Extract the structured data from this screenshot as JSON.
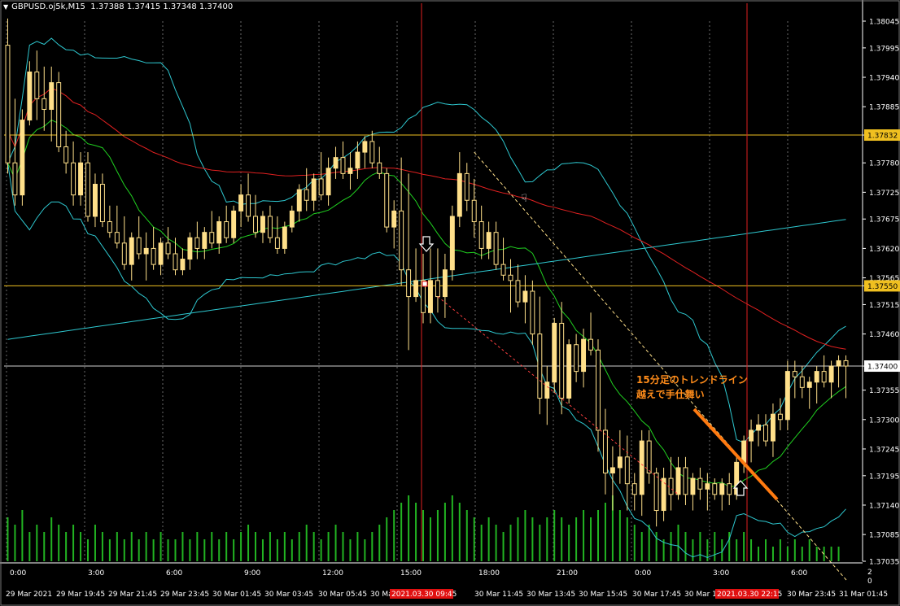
{
  "header": {
    "symbol_info": "GBPUSD.oj5k,M15",
    "ohlc": "1.37388 1.37415 1.37348 1.37400"
  },
  "colors": {
    "background": "#000000",
    "candle": "#ffe08a",
    "volume": "#22b422",
    "grid": "#6a6a6a",
    "ma_slow": "#e02020",
    "ma_mid": "#20d020",
    "ma_long": "#2ec8d0",
    "bollinger": "#2ec8d0",
    "level_line": "#f0c020",
    "time_marker": "#e02020",
    "trendline": "#ff7a10",
    "annotation_text": "#ff8c1a"
  },
  "annotation": {
    "line1": "15分足のトレンドライン",
    "line2": "越えで手仕舞い"
  },
  "icons": [
    "sell-arrow-icon",
    "buy-arrow-icon",
    "thumbs-down-icon"
  ],
  "chart_data": {
    "type": "candlestick",
    "ylim": [
      1.37035,
      1.38045
    ],
    "price_ticks": [
      "1.38045",
      "1.37995",
      "1.37940",
      "1.37885",
      "1.37832",
      "1.37780",
      "1.37725",
      "1.37675",
      "1.37620",
      "1.37565",
      "1.37550",
      "1.37515",
      "1.37460",
      "1.37400",
      "1.37355",
      "1.37300",
      "1.37245",
      "1.37195",
      "1.37140",
      "1.37085",
      "1.37035"
    ],
    "highlight_levels": [
      {
        "price": 1.37832,
        "label": "1.37832",
        "style": "yellow"
      },
      {
        "price": 1.3755,
        "label": "1.37550",
        "style": "yellow"
      },
      {
        "price": 1.374,
        "label": "1.37400",
        "style": "white"
      }
    ],
    "time_ticks_top": [
      "0:00",
      "3:00",
      "6:00",
      "9:00",
      "12:00",
      "15:00",
      "18:00",
      "21:00",
      "0:00",
      "3:00",
      "6:00"
    ],
    "time_ticks_bottom": [
      "29 Mar 2021",
      "29 Mar 19:45",
      "29 Mar 21:45",
      "29 Mar 23:45",
      "30 Mar 01:45",
      "30 Mar 03:45",
      "30 Mar 05:45",
      "30 Mar 0",
      "2021.03.30 09:45",
      "30 Mar 11:45",
      "30 Mar 13:45",
      "30 Mar 15:45",
      "30 Mar 17:45",
      "30 Mar 19",
      "2021.03.30 22:15",
      "30 Mar 23:45",
      "31 Mar 01:45"
    ],
    "marker_times": [
      "2021.03.30 09:45",
      "2021.03.30 22:15"
    ],
    "volume_axis_labels": [
      "2",
      "0"
    ],
    "candles": [
      [
        1.38,
        1.3805,
        1.3776,
        1.3778
      ],
      [
        1.3778,
        1.379,
        1.377,
        1.3772
      ],
      [
        1.3772,
        1.3788,
        1.377,
        1.3786
      ],
      [
        1.3786,
        1.3797,
        1.3785,
        1.3795
      ],
      [
        1.3795,
        1.3799,
        1.3786,
        1.379
      ],
      [
        1.379,
        1.3796,
        1.3784,
        1.3788
      ],
      [
        1.3788,
        1.3796,
        1.3782,
        1.3793
      ],
      [
        1.3793,
        1.3795,
        1.378,
        1.3781
      ],
      [
        1.3781,
        1.3784,
        1.3776,
        1.3778
      ],
      [
        1.3778,
        1.3782,
        1.377,
        1.3772
      ],
      [
        1.3772,
        1.378,
        1.377,
        1.3778
      ],
      [
        1.3778,
        1.378,
        1.3767,
        1.3768
      ],
      [
        1.3768,
        1.3776,
        1.3766,
        1.3774
      ],
      [
        1.3774,
        1.3776,
        1.3766,
        1.3767
      ],
      [
        1.3767,
        1.377,
        1.3764,
        1.3765
      ],
      [
        1.3765,
        1.377,
        1.3762,
        1.3763
      ],
      [
        1.3763,
        1.3768,
        1.3758,
        1.3759
      ],
      [
        1.3759,
        1.3765,
        1.3756,
        1.3764
      ],
      [
        1.3764,
        1.3768,
        1.376,
        1.3761
      ],
      [
        1.3761,
        1.3765,
        1.3756,
        1.3762
      ],
      [
        1.3762,
        1.3766,
        1.3758,
        1.3759
      ],
      [
        1.3759,
        1.3764,
        1.3757,
        1.3763
      ],
      [
        1.3763,
        1.3766,
        1.376,
        1.3761
      ],
      [
        1.3761,
        1.3764,
        1.3757,
        1.3758
      ],
      [
        1.3758,
        1.3762,
        1.3757,
        1.376
      ],
      [
        1.376,
        1.3765,
        1.3758,
        1.3764
      ],
      [
        1.3764,
        1.3767,
        1.376,
        1.3762
      ],
      [
        1.3762,
        1.3766,
        1.376,
        1.3765
      ],
      [
        1.3765,
        1.3769,
        1.3762,
        1.3763
      ],
      [
        1.3763,
        1.3768,
        1.3761,
        1.3767
      ],
      [
        1.3767,
        1.377,
        1.3763,
        1.3764
      ],
      [
        1.3764,
        1.377,
        1.3763,
        1.3769
      ],
      [
        1.3769,
        1.3774,
        1.3766,
        1.3772
      ],
      [
        1.3772,
        1.3776,
        1.3767,
        1.3768
      ],
      [
        1.3768,
        1.3772,
        1.3764,
        1.3765
      ],
      [
        1.3765,
        1.3769,
        1.3763,
        1.3768
      ],
      [
        1.3768,
        1.377,
        1.3763,
        1.3764
      ],
      [
        1.3764,
        1.3768,
        1.3761,
        1.3762
      ],
      [
        1.3762,
        1.3767,
        1.3761,
        1.3766
      ],
      [
        1.3766,
        1.377,
        1.3765,
        1.3769
      ],
      [
        1.3769,
        1.3774,
        1.3767,
        1.3773
      ],
      [
        1.3773,
        1.3777,
        1.3769,
        1.3771
      ],
      [
        1.3771,
        1.3776,
        1.3769,
        1.3775
      ],
      [
        1.3775,
        1.378,
        1.3771,
        1.3772
      ],
      [
        1.3772,
        1.3779,
        1.377,
        1.3777
      ],
      [
        1.3777,
        1.3781,
        1.3775,
        1.3779
      ],
      [
        1.3779,
        1.3782,
        1.3775,
        1.3776
      ],
      [
        1.3776,
        1.378,
        1.3773,
        1.3777
      ],
      [
        1.3777,
        1.3782,
        1.3775,
        1.378
      ],
      [
        1.378,
        1.3783,
        1.3777,
        1.3782
      ],
      [
        1.3782,
        1.3784,
        1.3777,
        1.3778
      ],
      [
        1.3778,
        1.3781,
        1.3775,
        1.3776
      ],
      [
        1.3776,
        1.3777,
        1.3765,
        1.3766
      ],
      [
        1.3766,
        1.3771,
        1.3762,
        1.3769
      ],
      [
        1.3769,
        1.3779,
        1.3755,
        1.3758
      ],
      [
        1.3758,
        1.3776,
        1.3743,
        1.3753
      ],
      [
        1.3753,
        1.3762,
        1.3752,
        1.3756
      ],
      [
        1.3756,
        1.3761,
        1.3748,
        1.375
      ],
      [
        1.375,
        1.3762,
        1.3748,
        1.3756
      ],
      [
        1.3756,
        1.3762,
        1.375,
        1.3753
      ],
      [
        1.3753,
        1.3761,
        1.3749,
        1.3758
      ],
      [
        1.3758,
        1.377,
        1.3756,
        1.3768
      ],
      [
        1.3768,
        1.378,
        1.3766,
        1.3776
      ],
      [
        1.3776,
        1.3778,
        1.3769,
        1.3771
      ],
      [
        1.3771,
        1.3775,
        1.3764,
        1.3767
      ],
      [
        1.3767,
        1.377,
        1.376,
        1.3762
      ],
      [
        1.3762,
        1.3767,
        1.376,
        1.3765
      ],
      [
        1.3765,
        1.3767,
        1.3758,
        1.3759
      ],
      [
        1.3759,
        1.3764,
        1.3756,
        1.3757
      ],
      [
        1.3757,
        1.376,
        1.375,
        1.3756
      ],
      [
        1.3756,
        1.3759,
        1.3751,
        1.3752
      ],
      [
        1.3752,
        1.3757,
        1.3748,
        1.3754
      ],
      [
        1.3754,
        1.3756,
        1.3744,
        1.3746
      ],
      [
        1.3746,
        1.3753,
        1.3731,
        1.3734
      ],
      [
        1.3734,
        1.374,
        1.3729,
        1.3737
      ],
      [
        1.3737,
        1.3749,
        1.3735,
        1.3748
      ],
      [
        1.3748,
        1.3752,
        1.3731,
        1.3734
      ],
      [
        1.3734,
        1.3745,
        1.3733,
        1.3744
      ],
      [
        1.3744,
        1.3746,
        1.3737,
        1.3739
      ],
      [
        1.3739,
        1.3747,
        1.3736,
        1.3745
      ],
      [
        1.3745,
        1.375,
        1.3742,
        1.3743
      ],
      [
        1.3743,
        1.3745,
        1.3724,
        1.3728
      ],
      [
        1.3728,
        1.3732,
        1.3716,
        1.372
      ],
      [
        1.372,
        1.3725,
        1.3713,
        1.3721
      ],
      [
        1.3721,
        1.3728,
        1.3718,
        1.3723
      ],
      [
        1.3723,
        1.3727,
        1.3713,
        1.3718
      ],
      [
        1.3718,
        1.372,
        1.3713,
        1.3716
      ],
      [
        1.3716,
        1.3728,
        1.3712,
        1.3726
      ],
      [
        1.3726,
        1.3728,
        1.3718,
        1.372
      ],
      [
        1.372,
        1.3721,
        1.371,
        1.3713
      ],
      [
        1.3713,
        1.3721,
        1.3711,
        1.3719
      ],
      [
        1.3719,
        1.3723,
        1.3713,
        1.3716
      ],
      [
        1.3716,
        1.3723,
        1.3715,
        1.3721
      ],
      [
        1.3721,
        1.3723,
        1.3714,
        1.3716
      ],
      [
        1.3716,
        1.372,
        1.3713,
        1.3719
      ],
      [
        1.3719,
        1.3721,
        1.3715,
        1.3717
      ],
      [
        1.3717,
        1.372,
        1.3713,
        1.3718
      ],
      [
        1.3718,
        1.3719,
        1.3715,
        1.3716
      ],
      [
        1.3716,
        1.3719,
        1.3713,
        1.3718
      ],
      [
        1.3718,
        1.372,
        1.3714,
        1.3716
      ],
      [
        1.3716,
        1.3723,
        1.3715,
        1.3722
      ],
      [
        1.3722,
        1.3727,
        1.372,
        1.3726
      ],
      [
        1.3726,
        1.373,
        1.3722,
        1.3728
      ],
      [
        1.3728,
        1.3731,
        1.3725,
        1.3729
      ],
      [
        1.3729,
        1.3731,
        1.3725,
        1.3726
      ],
      [
        1.3726,
        1.3733,
        1.3723,
        1.3731
      ],
      [
        1.3731,
        1.3734,
        1.3728,
        1.373
      ],
      [
        1.373,
        1.3741,
        1.3728,
        1.3739
      ],
      [
        1.3739,
        1.3741,
        1.3734,
        1.3738
      ],
      [
        1.3738,
        1.374,
        1.3734,
        1.3736
      ],
      [
        1.3736,
        1.3738,
        1.3732,
        1.3737
      ],
      [
        1.3737,
        1.374,
        1.3733,
        1.3739
      ],
      [
        1.3739,
        1.3742,
        1.3736,
        1.3737
      ],
      [
        1.3737,
        1.3741,
        1.3734,
        1.374
      ],
      [
        1.374,
        1.3742,
        1.3736,
        1.3741
      ],
      [
        1.3741,
        1.3742,
        1.3734,
        1.374
      ]
    ],
    "volumes": [
      6,
      5,
      7,
      4,
      5,
      4,
      6,
      5,
      4,
      5,
      4,
      3,
      5,
      4,
      3,
      4,
      3,
      4,
      3,
      4,
      3,
      4,
      3,
      3,
      4,
      3,
      4,
      3,
      4,
      3,
      4,
      3,
      4,
      5,
      4,
      3,
      4,
      3,
      4,
      3,
      4,
      5,
      4,
      3,
      4,
      5,
      4,
      3,
      4,
      3,
      4,
      5,
      6,
      7,
      8,
      9,
      8,
      7,
      6,
      7,
      8,
      9,
      8,
      7,
      6,
      5,
      6,
      5,
      4,
      5,
      6,
      7,
      6,
      5,
      6,
      7,
      6,
      5,
      6,
      7,
      6,
      7,
      8,
      9,
      7,
      6,
      5,
      4,
      5,
      4,
      3,
      4,
      5,
      4,
      3,
      4,
      3,
      4,
      3,
      4,
      3,
      4,
      3,
      2,
      3,
      2,
      3,
      2,
      3,
      2,
      3,
      2,
      2,
      2,
      2
    ]
  }
}
